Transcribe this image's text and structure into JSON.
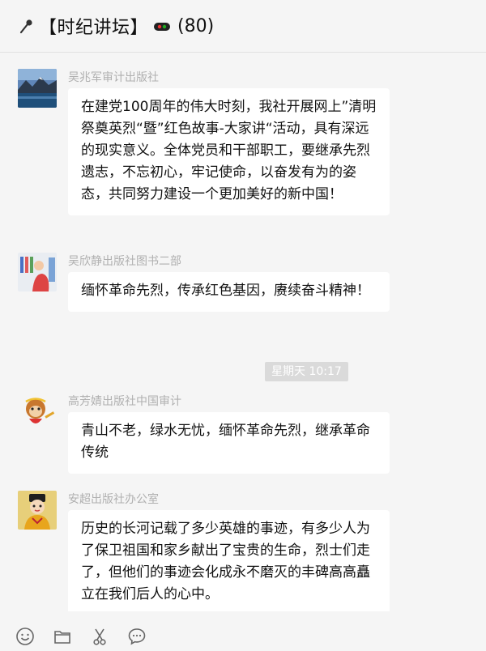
{
  "header": {
    "title": "【时纪讲坛】",
    "member_count": "(80)",
    "mic_icon": "microphone-icon",
    "emoji_icon": "pill-emoji-icon"
  },
  "messages": [
    {
      "sender": "吴兆军审计出版社",
      "avatar": "landscape-avatar",
      "text": "在建党100周年的伟大时刻，我社开展网上”清明祭奠英烈“暨”红色故事-大家讲“活动，具有深远的现实意义。全体党员和干部职工，要继承先烈遗志，不忘初心，牢记使命，以奋发有为的姿态，共同努力建设一个更加美好的新中国！"
    },
    {
      "sender": "吴欣静出版社图书二部",
      "avatar": "drawing-avatar",
      "text": "缅怀革命先烈，传承红色基因，赓续奋斗精神！"
    },
    {
      "sender": "高芳婧出版社中国审计",
      "avatar": "monkey-king-avatar",
      "text": "青山不老，绿水无忧，缅怀革命先烈，继承革命传统"
    },
    {
      "sender": "安超出版社办公室",
      "avatar": "child-emperor-avatar",
      "text": "历史的长河记载了多少英雄的事迹，有多少人为了保卫祖国和家乡献出了宝贵的生命，烈士们走了，但他们的事迹会化成永不磨灭的丰碑高高矗立在我们后人的心中。"
    }
  ],
  "timestamp": "星期天 10:17",
  "toolbar": {
    "icons": [
      "emoji-icon",
      "folder-icon",
      "scissors-icon",
      "chat-bubble-icon"
    ]
  },
  "colors": {
    "background": "#f5f5f5",
    "bubble": "#ffffff",
    "sender_text": "#b0b0b0",
    "timestamp_bg": "#dadada"
  }
}
